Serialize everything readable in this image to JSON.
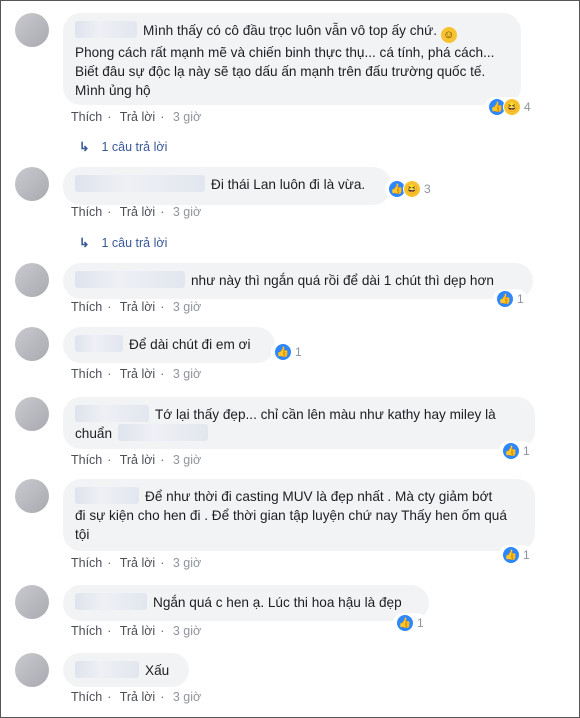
{
  "comments": [
    {
      "text": "Mình thấy có cô đầu trọc luôn vẫn vô top ấy chứ.",
      "text2": "Phong cách rất mạnh mẽ và chiến binh thực thụ... cá tính, phá cách... Biết đâu sự độc lạ này sẽ tạo dấu ấn mạnh trên đấu trường quốc tế. Mình ủng hộ",
      "reactions": "4",
      "like_label": "Thích",
      "reply_label": "Trả lời",
      "time": "3 giờ",
      "replies": "1 câu trả lời"
    },
    {
      "text": "Đi thái Lan luôn đi là vừa.",
      "reactions": "3",
      "like_label": "Thích",
      "reply_label": "Trả lời",
      "time": "3 giờ",
      "replies": "1 câu trả lời"
    },
    {
      "text": "như này thì ngắn quá rồi để dài 1 chút thì dẹp hơn",
      "reactions": "1",
      "like_label": "Thích",
      "reply_label": "Trả lời",
      "time": "3 giờ"
    },
    {
      "text": "Để dài chút đi em ơi",
      "reactions": "1",
      "like_label": "Thích",
      "reply_label": "Trả lời",
      "time": "3 giờ"
    },
    {
      "text": "Tớ lại thấy đẹp... chỉ cần lên màu như kathy hay miley là",
      "text2": "chuẩn",
      "reactions": "1",
      "like_label": "Thích",
      "reply_label": "Trả lời",
      "time": "3 giờ"
    },
    {
      "text": "Để như thời đi casting MUV là đẹp nhất . Mà cty giảm bớt",
      "text2": "đi sự kiện cho hen đi . Để thời gian tập luyện chứ nay Thấy hen ốm quá tội",
      "reactions": "1",
      "like_label": "Thích",
      "reply_label": "Trả lời",
      "time": "3 giờ"
    },
    {
      "text": "Ngắn quá c hen ạ. Lúc thi hoa hậu là đẹp",
      "reactions": "1",
      "like_label": "Thích",
      "reply_label": "Trả lời",
      "time": "3 giờ"
    },
    {
      "text": "Xấu",
      "like_label": "Thích",
      "reply_label": "Trả lời",
      "time": "3 giờ"
    }
  ],
  "separator": "·"
}
